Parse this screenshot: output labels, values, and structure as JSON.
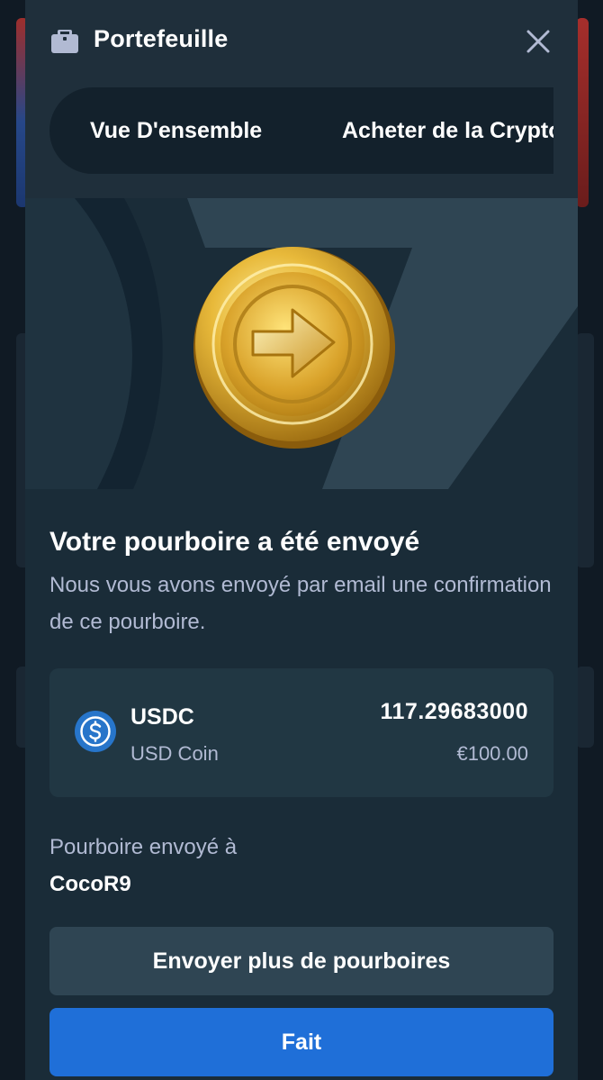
{
  "modal": {
    "title": "Portefeuille",
    "icon": "wallet-icon",
    "close_icon": "close-icon"
  },
  "tabs": [
    {
      "label": "Vue D'ensemble"
    },
    {
      "label": "Acheter de la Crypto"
    }
  ],
  "hero": {
    "image": "gold-coin-arrow-icon"
  },
  "confirmation": {
    "heading": "Votre pourboire a été envoyé",
    "message": "Nous vous avons envoyé par email une confirmation de ce pourboire."
  },
  "amount_card": {
    "currency_icon": "usdc-icon",
    "currency_code": "USDC",
    "currency_name": "USD Coin",
    "crypto_amount": "117.29683000",
    "fiat_amount": "€100.00"
  },
  "recipient": {
    "label": "Pourboire envoyé à",
    "name": "CocoR9"
  },
  "buttons": {
    "send_more": "Envoyer plus de pourboires",
    "done": "Fait"
  },
  "colors": {
    "modal_bg": "#1a2c38",
    "card_bg": "#213743",
    "secondary_button": "#2f4553",
    "primary_button": "#1f6fd8",
    "muted_text": "#b1bad3",
    "usdc_blue": "#2775ca"
  }
}
